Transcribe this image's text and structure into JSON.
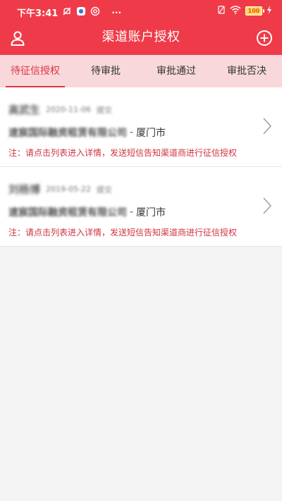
{
  "status_bar": {
    "time": "下午3:41",
    "dots": "···",
    "battery": "100"
  },
  "header": {
    "title": "渠道账户授权",
    "left_icon": "user-icon",
    "right_icon": "add-icon"
  },
  "tabs": [
    {
      "label": "待征信授权",
      "active": true
    },
    {
      "label": "待审批",
      "active": false
    },
    {
      "label": "审批通过",
      "active": false
    },
    {
      "label": "审批否决",
      "active": false
    }
  ],
  "items": [
    {
      "name": "高武生",
      "date": "2020-11-06",
      "submit_label": "提交",
      "company": "速宸国际融资租赁有限公司",
      "separator": "-",
      "city": "厦门市",
      "note": "注：请点击列表进入详情，发送短信告知渠道商进行征信授权"
    },
    {
      "name": "刘杨博",
      "date": "2019-05-22",
      "submit_label": "提交",
      "company": "速宸国际融资租赁有限公司",
      "separator": "-",
      "city": "厦门市",
      "note": "注：请点击列表进入详情，发送短信告知渠道商进行征信授权"
    }
  ],
  "colors": {
    "header_bg": "#ef3b49",
    "tab_bg": "#f8d8da",
    "accent": "#e23441",
    "note": "#cf3440"
  }
}
